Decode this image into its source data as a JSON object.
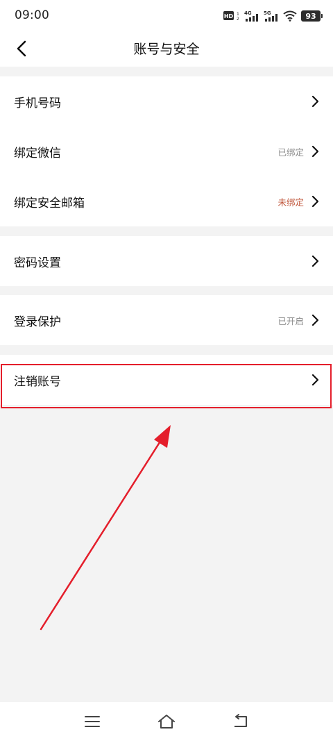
{
  "status_bar": {
    "time": "09:00",
    "battery": "93",
    "hd_label": "HD",
    "network_1": "4G",
    "network_2": "5G"
  },
  "header": {
    "title": "账号与安全"
  },
  "settings": {
    "phone": {
      "label": "手机号码"
    },
    "wechat": {
      "label": "绑定微信",
      "value": "已绑定"
    },
    "email": {
      "label": "绑定安全邮箱",
      "value": "未绑定"
    },
    "password": {
      "label": "密码设置"
    },
    "login_protect": {
      "label": "登录保护",
      "value": "已开启"
    },
    "deactivate": {
      "label": "注销账号"
    }
  },
  "colors": {
    "highlight": "#e41e2b",
    "unbound_text": "#c0553a",
    "muted_text": "#8a8a8a"
  },
  "icons": {
    "back": "chevron-left-icon",
    "row": "chevron-right-icon",
    "nav": [
      "menu-icon",
      "home-icon",
      "back-return-icon"
    ]
  }
}
